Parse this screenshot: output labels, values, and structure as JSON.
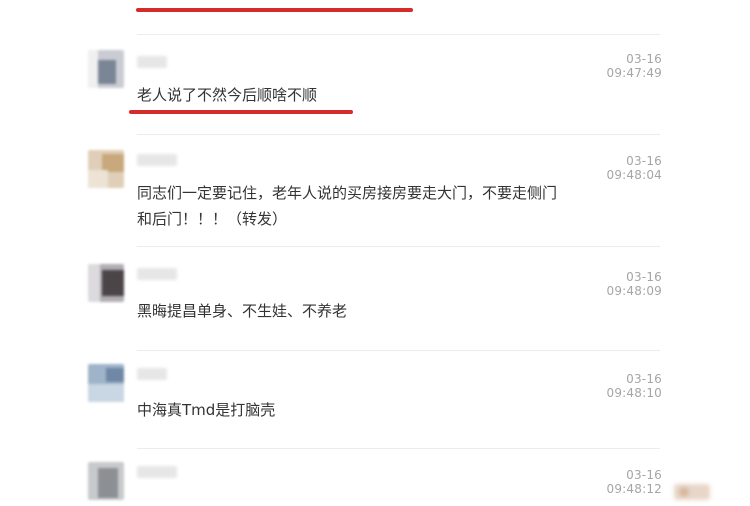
{
  "colors": {
    "underline": "#d62b2b",
    "timestamp": "#a5a5a5",
    "text": "#333333",
    "divider": "#ececec"
  },
  "comments": [
    {
      "time": "03-16 09:47:49",
      "text": "老人说了不然今后顺啥不顺",
      "underlined": true
    },
    {
      "time": "03-16 09:48:04",
      "text_line1": "同志们一定要记住，老年人说的买房接房要走大门，不要走侧门",
      "text_line2": "和后门！！！（转发）"
    },
    {
      "time": "03-16 09:48:09",
      "text": "黑晦提昌单身、不生娃、不养老"
    },
    {
      "time": "03-16 09:48:10",
      "text": "中海真Tmd是打脑壳"
    },
    {
      "time": "03-16 09:48:12",
      "text": ""
    }
  ]
}
